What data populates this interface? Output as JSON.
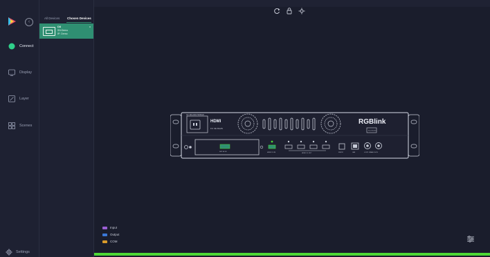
{
  "sidebar": {
    "collapse_icon": "chevron-left-icon",
    "items": [
      {
        "label": "Connect",
        "icon": "status-dot-icon",
        "active": true
      },
      {
        "label": "Display",
        "icon": "monitor-icon",
        "active": false
      },
      {
        "label": "Layer",
        "icon": "edit-icon",
        "active": false
      },
      {
        "label": "Scenes",
        "icon": "grid-icon",
        "active": false
      }
    ],
    "settings_label": "Settings"
  },
  "device_panel": {
    "tabs": [
      {
        "label": "All Devices",
        "active": false
      },
      {
        "label": "Chosen Devices",
        "active": true
      }
    ],
    "device": {
      "name": "D8",
      "line1": "SN:Demo",
      "line2": "IP: Demo",
      "corner_icon": "x"
    }
  },
  "toolbar": {
    "refresh_icon": "refresh-icon",
    "lock_icon": "lock-icon",
    "center_icon": "crosshair-icon"
  },
  "device_front": {
    "brand": "RGBlink",
    "badge": "Serial Number",
    "hdmi_logo": "HDMI",
    "label_top": "AC 100-240V 50/60Hz",
    "ce_label": "FC CE RoHS",
    "ports": [
      {
        "label": "HDMI 2.0 IN"
      },
      {
        "label": "HDMI 2.0 OUT"
      },
      {
        "label": "RS232"
      },
      {
        "label": "LAN"
      },
      {
        "label": "LOOP / ANALOG IN"
      }
    ],
    "slot_label": "SFP 4K IN"
  },
  "legend": [
    {
      "label": "Input",
      "color": "#9b5fd4"
    },
    {
      "label": "Output",
      "color": "#3a78d8"
    },
    {
      "label": "COM",
      "color": "#d89a2a"
    }
  ],
  "colors": {
    "accent": "#2f8f72",
    "status_bar": "#4ed836",
    "background": "#1a1d2c"
  },
  "filter_icon": "sliders-icon"
}
